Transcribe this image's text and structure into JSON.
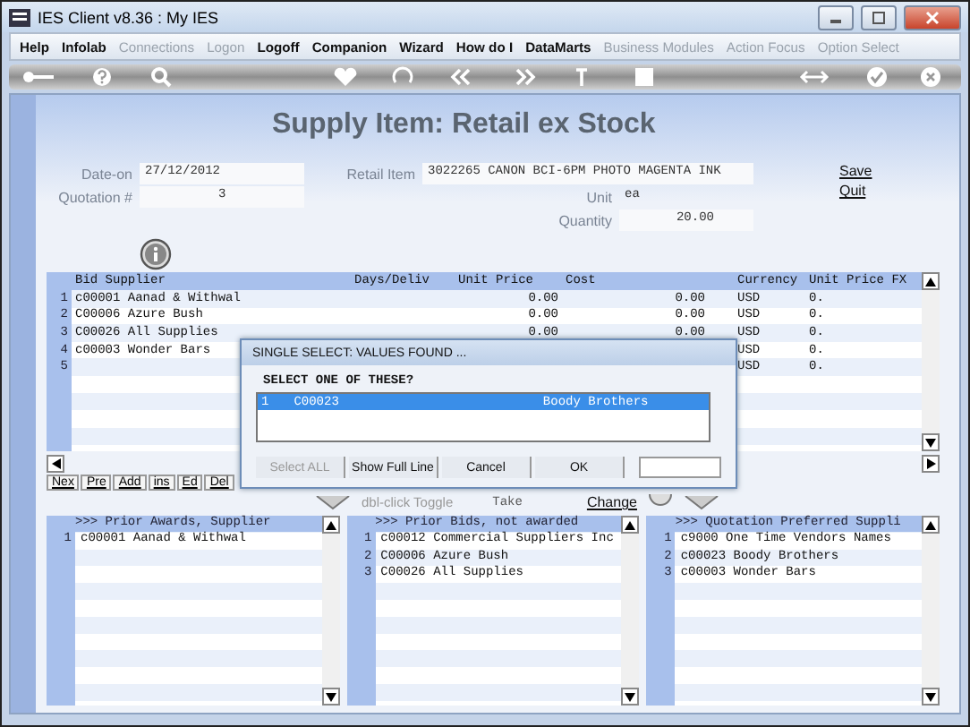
{
  "window": {
    "title": "IES Client v8.36 : My IES"
  },
  "menu": [
    {
      "label": "Help",
      "disabled": false
    },
    {
      "label": "Infolab",
      "disabled": false
    },
    {
      "label": "Connections",
      "disabled": true
    },
    {
      "label": "Logon",
      "disabled": true
    },
    {
      "label": "Logoff",
      "disabled": false
    },
    {
      "label": "Companion",
      "disabled": false
    },
    {
      "label": "Wizard",
      "disabled": false
    },
    {
      "label": "How do I",
      "disabled": false
    },
    {
      "label": "DataMarts",
      "disabled": false
    },
    {
      "label": "Business Modules",
      "disabled": true
    },
    {
      "label": "Action Focus",
      "disabled": true
    },
    {
      "label": "Option Select",
      "disabled": true
    }
  ],
  "page_title": "Supply Item: Retail ex Stock",
  "form": {
    "date_label": "Date-on",
    "date": "27/12/2012",
    "quotation_label": "Quotation #",
    "quotation": "3",
    "retail_item_label": "Retail Item",
    "retail_item": "3022265 CANON BCI-6PM PHOTO MAGENTA INK",
    "unit_label": "Unit",
    "unit": "ea",
    "quantity_label": "Quantity",
    "quantity": "20.00"
  },
  "links": [
    "Save",
    "Quit"
  ],
  "grid": {
    "columns": [
      "Bid Supplier",
      "Days/Deliv",
      "Unit Price",
      "Cost",
      "Currency",
      "Unit Price FX"
    ],
    "rows": [
      {
        "index": "1",
        "cells": [
          "c00001 Aanad & Withwal",
          "",
          "0.00",
          "0.00",
          "USD",
          "0."
        ]
      },
      {
        "index": "2",
        "cells": [
          "C00006 Azure Bush",
          "",
          "0.00",
          "0.00",
          "USD",
          "0."
        ]
      },
      {
        "index": "3",
        "cells": [
          "C00026 All Supplies",
          "",
          "0.00",
          "0.00",
          "USD",
          "0."
        ]
      },
      {
        "index": "4",
        "cells": [
          "c00003 Wonder Bars",
          "",
          "",
          "",
          "USD",
          "0."
        ]
      },
      {
        "index": "5",
        "cells": [
          "",
          "",
          "",
          "",
          "USD",
          "0."
        ]
      }
    ]
  },
  "record_buttons": [
    "Nex",
    "Pre",
    "Add",
    "ins",
    "Ed",
    "Del"
  ],
  "toggle_bar": {
    "hint": "dbl-click Toggle",
    "take": "Take",
    "change": "Change"
  },
  "lists": [
    {
      "title": ">>> Prior Awards, Supplier",
      "rows": [
        {
          "index": "1",
          "text": "c00001 Aanad & Withwal"
        }
      ]
    },
    {
      "title": ">>> Prior Bids, not awarded",
      "rows": [
        {
          "index": "1",
          "text": "c00012 Commercial Suppliers Inc"
        },
        {
          "index": "2",
          "text": "C00006 Azure Bush"
        },
        {
          "index": "3",
          "text": "C00026 All Supplies"
        }
      ]
    },
    {
      "title": ">>> Quotation Preferred Suppli",
      "rows": [
        {
          "index": "1",
          "text": "c9000 One Time Vendors Names"
        },
        {
          "index": "2",
          "text": "c00023 Boody Brothers"
        },
        {
          "index": "3",
          "text": "c00003 Wonder Bars"
        }
      ]
    }
  ],
  "dialog": {
    "title": "SINGLE SELECT: VALUES FOUND ...",
    "prompt": "SELECT ONE OF THESE?",
    "options": [
      {
        "index": "1",
        "code": "C00023",
        "name": "Boody Brothers",
        "selected": true
      }
    ],
    "buttons": [
      {
        "label": "Select ALL",
        "disabled": true
      },
      {
        "label": "Show Full Line",
        "disabled": false
      },
      {
        "label": "Cancel",
        "disabled": false
      },
      {
        "label": "OK",
        "disabled": false
      }
    ]
  }
}
